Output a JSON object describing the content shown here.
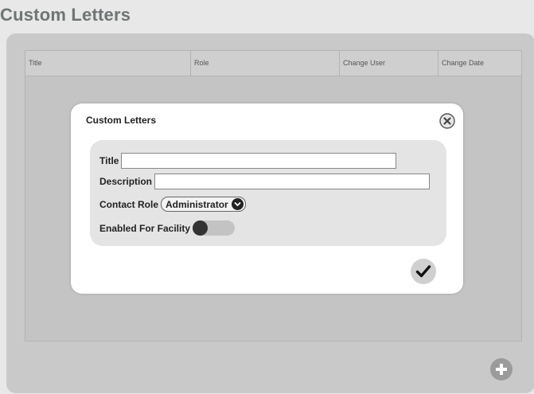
{
  "page": {
    "title": "Custom Letters"
  },
  "grid": {
    "columns": [
      "Title",
      "Role",
      "Change User",
      "Change Date"
    ]
  },
  "modal": {
    "title": "Custom Letters",
    "fields": {
      "title": {
        "label": "Title",
        "value": ""
      },
      "description": {
        "label": "Description",
        "value": ""
      },
      "contact_role": {
        "label": "Contact Role",
        "selected": "Administrator"
      },
      "enabled_for_facility": {
        "label": "Enabled For Facility",
        "checked": false
      }
    }
  },
  "icons": {
    "close": "close-icon",
    "confirm": "checkmark-icon",
    "add": "plus-icon",
    "dropdown": "chevron-down-icon"
  }
}
